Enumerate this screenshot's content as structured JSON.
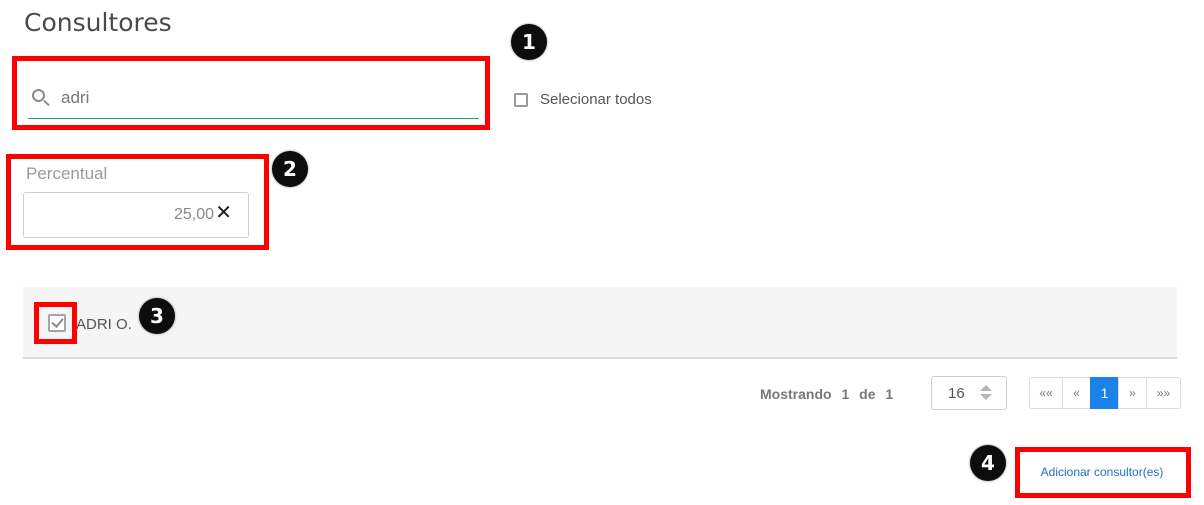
{
  "page": {
    "title": "Consultores"
  },
  "search": {
    "value": "adri"
  },
  "select_all": {
    "label": "Selecionar todos"
  },
  "percentual": {
    "label": "Percentual",
    "value": "25,00",
    "clear_icon": "close-icon"
  },
  "list": {
    "items": [
      {
        "label": "ADRI O.",
        "checked": true
      }
    ]
  },
  "pagination": {
    "mostrando_label": "Mostrando",
    "current": "1",
    "de_label": "de",
    "total": "1",
    "page_size": "16",
    "buttons": [
      "««",
      "«",
      "1",
      "»",
      "»»"
    ]
  },
  "actions": {
    "add_label": "Adicionar consultor(es)"
  },
  "annotations": {
    "badges": [
      "1",
      "2",
      "3",
      "4"
    ],
    "highlight_color": "#ff0000"
  },
  "colors": {
    "accent": "#1a82e8",
    "link": "#1a6fd1",
    "underline": "#1f9a8a"
  }
}
